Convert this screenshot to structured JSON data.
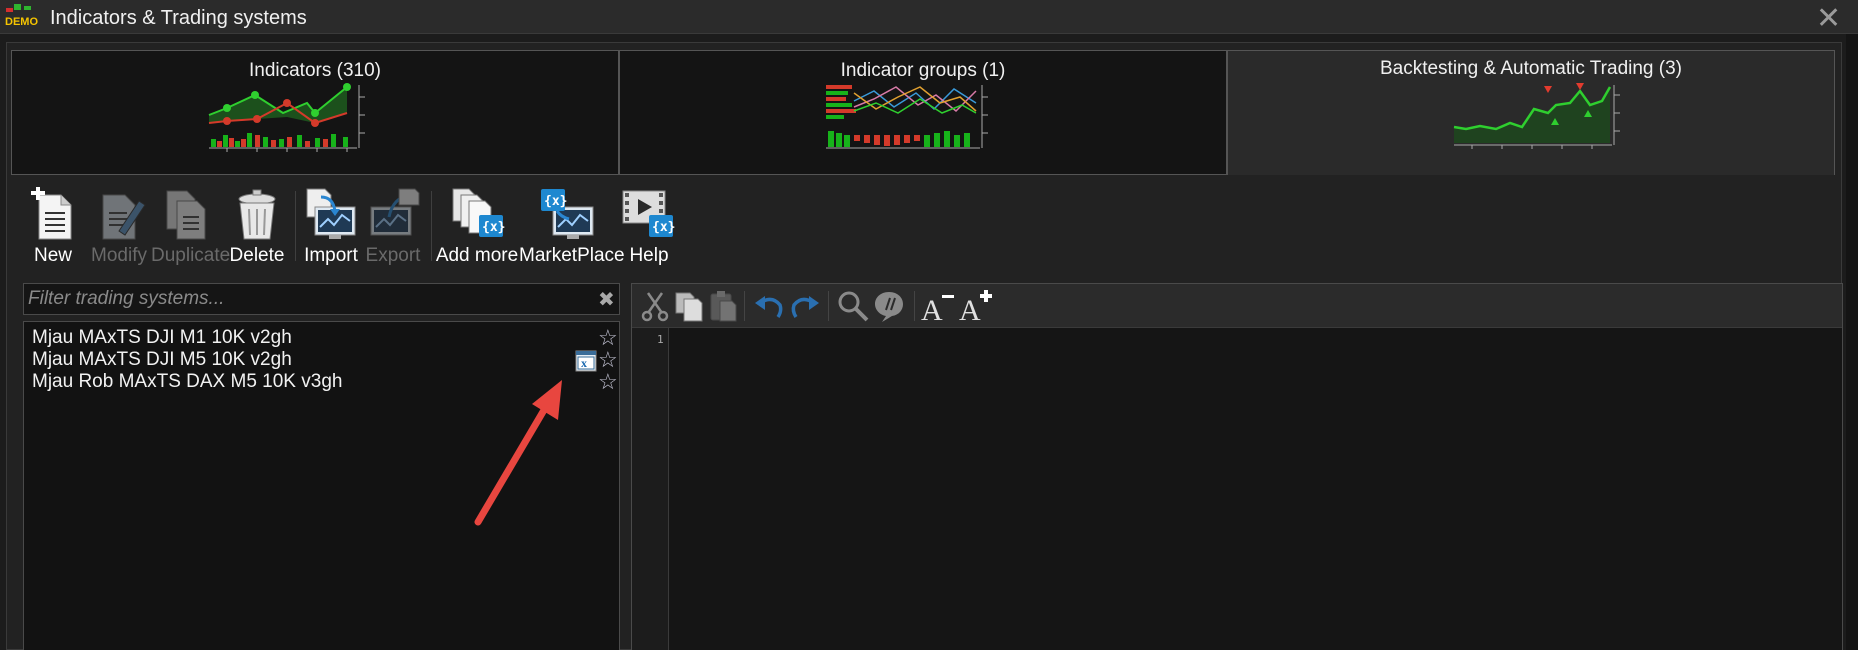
{
  "window": {
    "title": "Indicators & Trading systems",
    "logo_text": "DEMO"
  },
  "tabs": [
    {
      "label": "Indicators (310)"
    },
    {
      "label": "Indicator groups (1)"
    },
    {
      "label": "Backtesting & Automatic Trading (3)"
    }
  ],
  "toolbar": {
    "new": "New",
    "modify": "Modify",
    "duplicate": "Duplicate",
    "delete": "Delete",
    "import": "Import",
    "export": "Export",
    "add_more": "Add more",
    "marketplace": "MarketPlace",
    "help": "Help"
  },
  "filter": {
    "placeholder": "Filter trading systems...",
    "value": ""
  },
  "systems": [
    {
      "name": "Mjau MAxTS DJI M1 10K v2gh"
    },
    {
      "name": "Mjau MAxTS DJI M5 10K v2gh"
    },
    {
      "name": "Mjau Rob MAxTS DAX M5 10K v3gh"
    }
  ],
  "editor": {
    "line_number": "1"
  },
  "colors": {
    "annotation_arrow": "#e8463f",
    "chart_green": "#17b21a",
    "chart_red": "#d43a2a"
  }
}
